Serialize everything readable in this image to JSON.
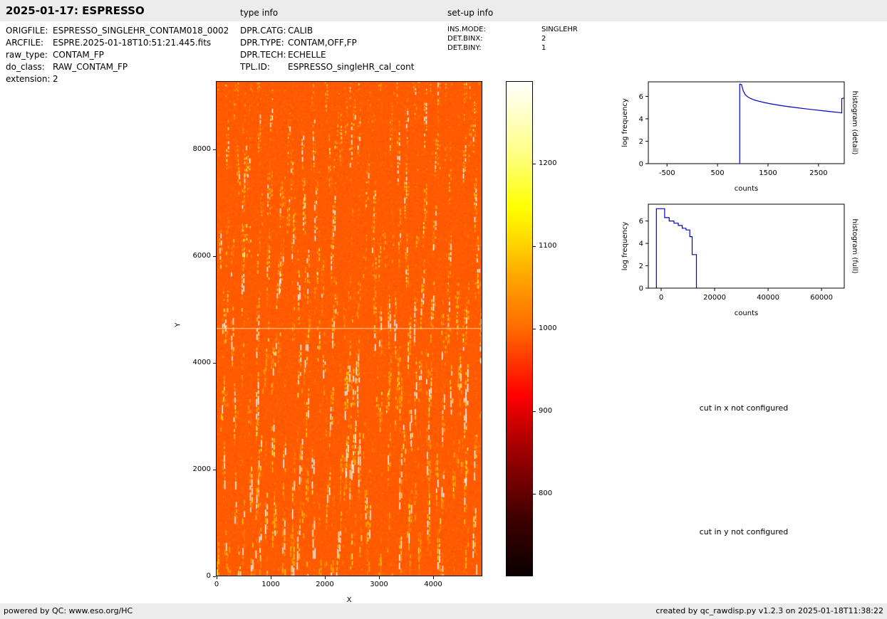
{
  "header": {
    "title": "2025-01-17: ESPRESSO",
    "type_info_label": "type info",
    "setup_info_label": "set-up info"
  },
  "metadata": {
    "general": [
      {
        "label": "ORIGFILE:",
        "value": "ESPRESSO_SINGLEHR_CONTAM018_0002"
      },
      {
        "label": "ARCFILE:",
        "value": "ESPRE.2025-01-18T10:51:21.445.fits"
      },
      {
        "label": "raw_type:",
        "value": "CONTAM_FP"
      },
      {
        "label": "do_class:",
        "value": "RAW_CONTAM_FP"
      },
      {
        "label": "extension:",
        "value": "2"
      }
    ],
    "type_info": [
      {
        "label": "DPR.CATG:",
        "value": "CALIB"
      },
      {
        "label": "DPR.TYPE:",
        "value": "CONTAM,OFF,FP"
      },
      {
        "label": "DPR.TECH:",
        "value": "ECHELLE"
      },
      {
        "label": "TPL.ID:",
        "value": "ESPRESSO_singleHR_cal_cont"
      }
    ],
    "setup_info": [
      {
        "label": "INS.MODE:",
        "value": "SINGLEHR"
      },
      {
        "label": "DET.BINX:",
        "value": "2"
      },
      {
        "label": "DET.BINY:",
        "value": "1"
      }
    ]
  },
  "annotations": {
    "cut_x": "cut in x not configured",
    "cut_y": "cut in y not configured"
  },
  "footer": {
    "left": "powered by QC: www.eso.org/HC",
    "right": "created by qc_rawdisp.py v1.2.3 on 2025-01-18T11:38:22"
  },
  "chart_data": [
    {
      "type": "heatmap",
      "name": "raw frame display",
      "xlabel": "X",
      "ylabel": "Y",
      "xlim": [
        0,
        4895
      ],
      "ylim": [
        0,
        9280
      ],
      "x_ticks": [
        0,
        1000,
        2000,
        3000,
        4000
      ],
      "y_ticks": [
        0,
        2000,
        4000,
        6000,
        8000
      ],
      "colormap": "hot",
      "colorbar_ticks": [
        800,
        900,
        1000,
        1100,
        1200
      ],
      "colorbar_range": [
        700,
        1300
      ],
      "background_level": 1000,
      "gap_line_y": 4650,
      "description": "ESPRESSO raw CONTAM_FP echelle exposure: dense vertical fiber order traces with yellow-white Fabry-Perot emission speckles on an orange ~1000-count background; thin brighter horizontal detector gap near y=4650"
    },
    {
      "type": "line",
      "name": "histogram (detail)",
      "xlabel": "counts",
      "ylabel": "log frequency",
      "xlim": [
        -870,
        3010
      ],
      "ylim": [
        0,
        7.3
      ],
      "x_ticks": [
        -500,
        500,
        1500,
        2500
      ],
      "y_ticks": [
        0,
        2,
        4,
        6
      ],
      "color": "#0000cd",
      "x": [
        940,
        940,
        975,
        1010,
        1050,
        1100,
        1160,
        1230,
        1320,
        1420,
        1530,
        1650,
        1780,
        1920,
        2070,
        2230,
        2400,
        2580,
        2770,
        2930,
        2960,
        2960,
        3000
      ],
      "y": [
        0,
        7.1,
        7.05,
        6.5,
        6.15,
        5.95,
        5.8,
        5.68,
        5.57,
        5.46,
        5.36,
        5.26,
        5.17,
        5.08,
        4.99,
        4.9,
        4.81,
        4.72,
        4.63,
        4.55,
        4.52,
        5.8,
        5.85
      ]
    },
    {
      "type": "line",
      "name": "histogram (full)",
      "xlabel": "counts",
      "ylabel": "log frequency",
      "xlim": [
        -4800,
        68500
      ],
      "ylim": [
        0,
        7.5
      ],
      "x_ticks": [
        0,
        20000,
        40000,
        60000
      ],
      "y_ticks": [
        0,
        2,
        4,
        6
      ],
      "color": "#0000cd",
      "x": [
        -1800,
        -1800,
        1300,
        1300,
        3000,
        3000,
        4800,
        4800,
        6400,
        6400,
        7900,
        7900,
        9300,
        9300,
        10700,
        10700,
        11600,
        11600,
        13200,
        13200
      ],
      "y": [
        0,
        7.1,
        7.1,
        6.3,
        6.3,
        6.0,
        6.0,
        5.8,
        5.8,
        5.6,
        5.6,
        5.35,
        5.35,
        5.2,
        5.2,
        4.6,
        4.6,
        3.0,
        3.0,
        0
      ]
    }
  ]
}
